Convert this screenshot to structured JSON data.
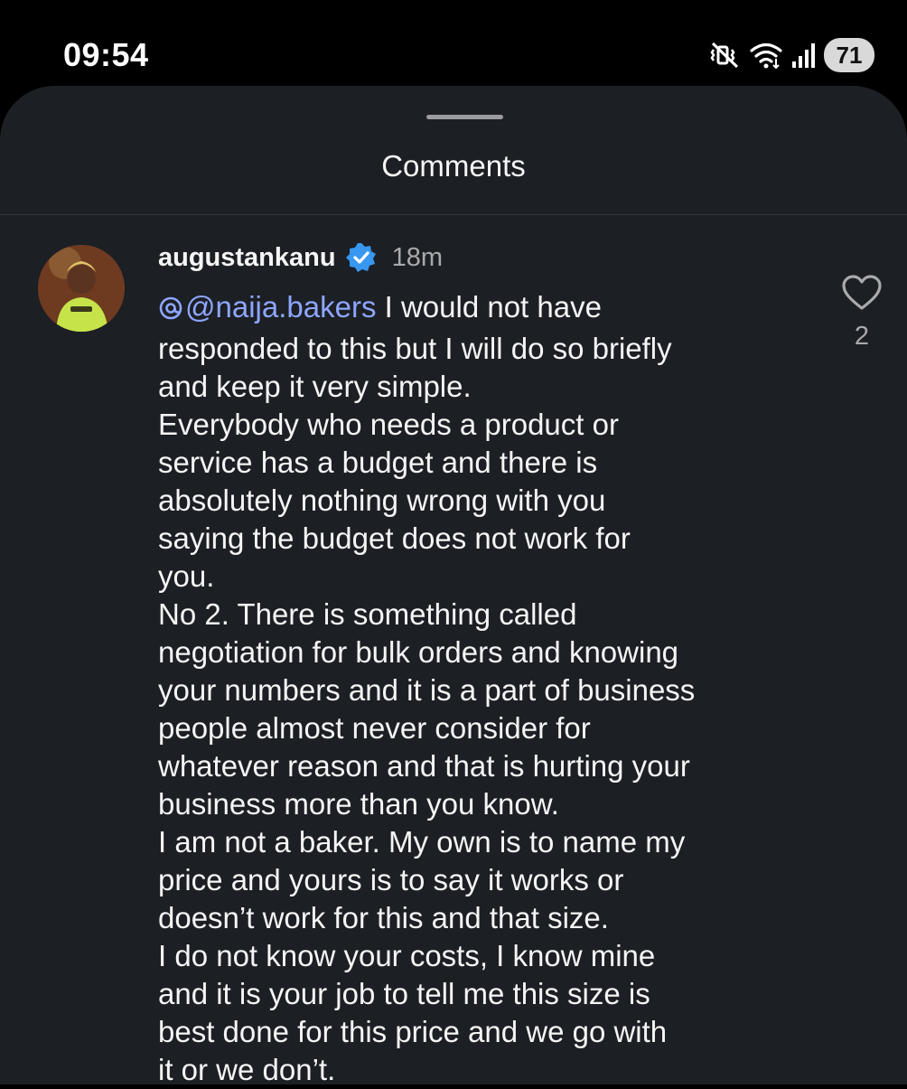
{
  "status_bar": {
    "time": "09:54",
    "battery": "71",
    "icons": [
      "mute-vibrate-icon",
      "wifi-icon",
      "signal-icon",
      "battery-icon"
    ]
  },
  "sheet": {
    "title": "Comments"
  },
  "comment": {
    "username": "augustankanu",
    "verified": true,
    "timestamp": "18m",
    "mention": "@naija.bakers",
    "first_line_rest": " I would not have",
    "lines": [
      "responded to this but I will do so briefly",
      "and keep it very simple.",
      "Everybody who needs a product or",
      "service has a budget and there is",
      "absolutely nothing wrong with you",
      "saying the budget does not work for",
      "you.",
      "No 2. There is something called",
      "negotiation for bulk orders and knowing",
      "your numbers and it is a part of business",
      "people almost never consider for",
      "whatever reason and that is hurting your",
      "business more than you know.",
      "I am not a baker. My own is to name my",
      "price and yours is to say it works or",
      "doesn’t work for this and that size.",
      "I do not know your costs, I know mine",
      "and it is your job to tell me this size is",
      "best done for this price and we go with",
      "it or we don’t."
    ],
    "like_count": "2"
  },
  "colors": {
    "background": "#000000",
    "sheet": "#1c1f24",
    "text": "#f5f5f5",
    "muted": "#a8aaae",
    "mention": "#8ea6ff",
    "verified": "#3897f0"
  }
}
